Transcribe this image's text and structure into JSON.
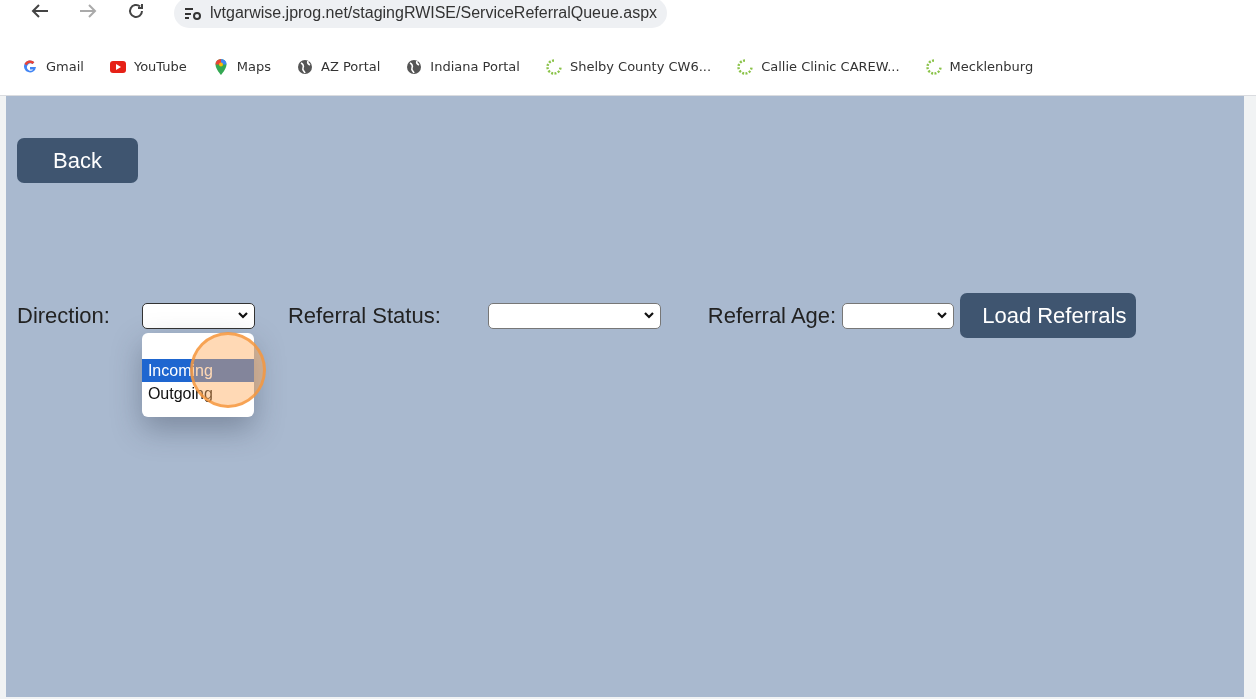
{
  "browser": {
    "url": "lvtgarwise.jprog.net/stagingRWISE/ServiceReferralQueue.aspx"
  },
  "bookmarks": [
    {
      "label": "Gmail",
      "kind": "google"
    },
    {
      "label": "YouTube",
      "kind": "youtube"
    },
    {
      "label": "Maps",
      "kind": "maps"
    },
    {
      "label": "AZ Portal",
      "kind": "globe"
    },
    {
      "label": "Indiana Portal",
      "kind": "globe"
    },
    {
      "label": "Shelby County CW6...",
      "kind": "spinner"
    },
    {
      "label": "Callie Clinic CAREW...",
      "kind": "spinner"
    },
    {
      "label": "Mecklenburg",
      "kind": "spinner"
    }
  ],
  "back_button": "Back",
  "filters": [
    {
      "label": "Direction:",
      "open": true,
      "options": [
        {
          "label": "Incoming",
          "selected": true
        },
        {
          "label": "Outgoing",
          "selected": false
        }
      ]
    },
    {
      "label": "Referral Status:",
      "open": false
    },
    {
      "label": "Referral Age:",
      "open": false
    }
  ],
  "load_button": "Load Referrals",
  "click_marker": {
    "shown": true
  }
}
